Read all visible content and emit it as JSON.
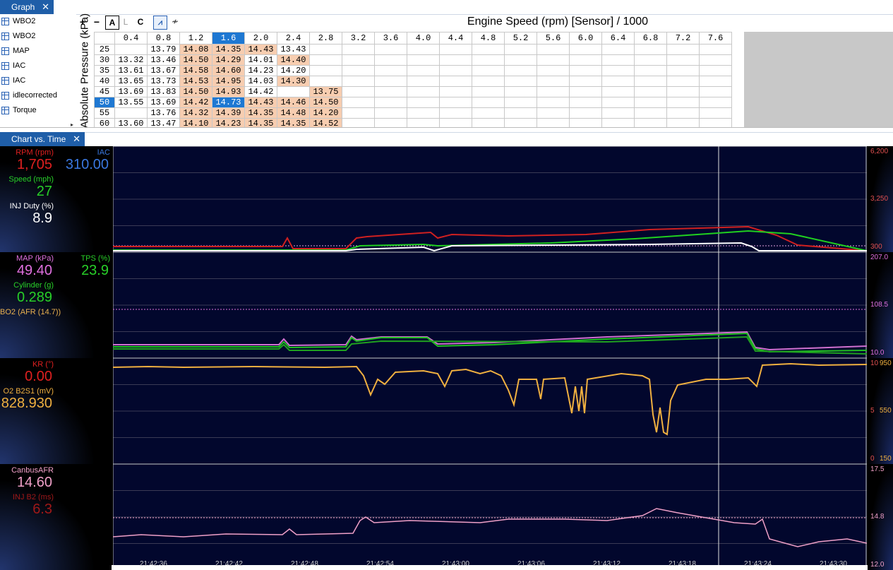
{
  "top_tab": {
    "label": "Graph",
    "close": "✕"
  },
  "channels": [
    "WBO2",
    "WBO2",
    "MAP",
    "IAC",
    "IAC",
    "idlecorrected",
    "Torque"
  ],
  "toolbar": {
    "plus": "+",
    "minus": "−",
    "a": "A",
    "l": "L",
    "c": "C",
    "graph1": "⩘",
    "graph2": "≁"
  },
  "table": {
    "title": "Engine Speed (rpm) [Sensor] / 1000",
    "y_axis": "Absolute Pressure (kPa)",
    "columns": [
      "0.4",
      "0.8",
      "1.2",
      "1.6",
      "2.0",
      "2.4",
      "2.8",
      "3.2",
      "3.6",
      "4.0",
      "4.4",
      "4.8",
      "5.2",
      "5.6",
      "6.0",
      "6.4",
      "6.8",
      "7.2",
      "7.6"
    ],
    "selected_col": 3,
    "rows": [
      {
        "kpa": "25",
        "cells": [
          "",
          "13.79",
          "14.08",
          "14.35",
          "14.43",
          "13.43",
          "",
          "",
          "",
          "",
          "",
          "",
          "",
          "",
          "",
          "",
          "",
          "",
          ""
        ],
        "hl": [
          2,
          3,
          4
        ]
      },
      {
        "kpa": "30",
        "cells": [
          "13.32",
          "13.46",
          "14.50",
          "14.29",
          "14.01",
          "14.40",
          "",
          "",
          "",
          "",
          "",
          "",
          "",
          "",
          "",
          "",
          "",
          "",
          ""
        ],
        "hl": [
          2,
          3,
          5
        ]
      },
      {
        "kpa": "35",
        "cells": [
          "13.61",
          "13.67",
          "14.58",
          "14.60",
          "14.23",
          "14.20",
          "",
          "",
          "",
          "",
          "",
          "",
          "",
          "",
          "",
          "",
          "",
          "",
          ""
        ],
        "hl": [
          2,
          3
        ]
      },
      {
        "kpa": "40",
        "cells": [
          "13.65",
          "13.73",
          "14.53",
          "14.95",
          "14.03",
          "14.30",
          "",
          "",
          "",
          "",
          "",
          "",
          "",
          "",
          "",
          "",
          "",
          "",
          ""
        ],
        "hl": [
          2,
          3,
          5
        ]
      },
      {
        "kpa": "45",
        "cells": [
          "13.69",
          "13.83",
          "14.50",
          "14.93",
          "14.42",
          "",
          "13.75",
          "",
          "",
          "",
          "",
          "",
          "",
          "",
          "",
          "",
          "",
          "",
          ""
        ],
        "hl": [
          2,
          3,
          6
        ]
      },
      {
        "kpa": "50",
        "cells": [
          "13.55",
          "13.69",
          "14.42",
          "14.73",
          "14.43",
          "14.46",
          "14.50",
          "",
          "",
          "",
          "",
          "",
          "",
          "",
          "",
          "",
          "",
          "",
          ""
        ],
        "hl": [
          2,
          4,
          5,
          6
        ],
        "selected": true
      },
      {
        "kpa": "55",
        "cells": [
          "",
          "13.76",
          "14.32",
          "14.39",
          "14.35",
          "14.48",
          "14.20",
          "",
          "",
          "",
          "",
          "",
          "",
          "",
          "",
          "",
          "",
          "",
          ""
        ],
        "hl": [
          2,
          3,
          4,
          5,
          6
        ]
      },
      {
        "kpa": "60",
        "cells": [
          "13.60",
          "13.47",
          "14.10",
          "14.23",
          "14.35",
          "14.35",
          "14.52",
          "",
          "",
          "",
          "",
          "",
          "",
          "",
          "",
          "",
          "",
          "",
          ""
        ],
        "hl": [
          2,
          3,
          4,
          5,
          6
        ]
      }
    ]
  },
  "chart_tab": {
    "label": "Chart vs. Time",
    "close": "✕"
  },
  "panels": [
    {
      "labels": [
        {
          "name": "RPM (rpm)",
          "value": "1,705",
          "color": "#e02020"
        },
        {
          "name": "Speed (mph)",
          "value": "27",
          "color": "#28d028"
        },
        {
          "name": "INJ Duty (%)",
          "value": "8.9",
          "color": "#ffffff"
        }
      ],
      "extra": {
        "name": "IAC",
        "value": "310.00",
        "color": "#3a78e0"
      },
      "scale": [
        {
          "t": "6,200",
          "c": "#e05050"
        },
        {
          "t": "3,250",
          "c": "#e05050"
        },
        {
          "t": "300",
          "c": "#e05050"
        }
      ]
    },
    {
      "labels": [
        {
          "name": "MAP (kPa)",
          "value": "49.40",
          "color": "#e070e0"
        },
        {
          "name": "Cylinder (g)",
          "value": "0.289",
          "color": "#28d028"
        },
        {
          "name": "BO2 (AFR (14.7))",
          "value": "",
          "color": "#e8b050"
        }
      ],
      "extra": {
        "name": "TPS (%)",
        "value": "23.9",
        "color": "#28d028"
      },
      "scale": [
        {
          "t": "207.0",
          "c": "#e070e0"
        },
        {
          "t": "108.5",
          "c": "#e070e0"
        },
        {
          "t": "10.0",
          "c": "#e070e0"
        }
      ]
    },
    {
      "labels": [
        {
          "name": "KR (°)",
          "value": "0.00",
          "color": "#e02020"
        },
        {
          "name": "O2 B2S1 (mV)",
          "value": "828.930",
          "color": "#f0b040"
        }
      ],
      "scale": [
        {
          "t": "10",
          "c": "#e05050"
        },
        {
          "t": "950",
          "c": "#f0b040"
        },
        {
          "t": "5",
          "c": "#e05050"
        },
        {
          "t": "550",
          "c": "#f0b040"
        },
        {
          "t": "0",
          "c": "#e05050"
        },
        {
          "t": "150",
          "c": "#f0b040"
        }
      ]
    },
    {
      "labels": [
        {
          "name": "CanbusAFR",
          "value": "14.60",
          "color": "#f0a0c8"
        },
        {
          "name": "INJ B2 (ms)",
          "value": "6.3",
          "color": "#a01818"
        }
      ],
      "scale": [
        {
          "t": "17.5",
          "c": "#f0a0c8"
        },
        {
          "t": "14.8",
          "c": "#f0a0c8"
        },
        {
          "t": "12.0",
          "c": "#f0a0c8"
        }
      ]
    }
  ],
  "time_ticks": [
    "21:42:36",
    "21:42:42",
    "21:42:48",
    "21:42:54",
    "21:43:00",
    "21:43:06",
    "21:43:12",
    "21:43:18",
    "21:43:24",
    "21:43:30"
  ]
}
